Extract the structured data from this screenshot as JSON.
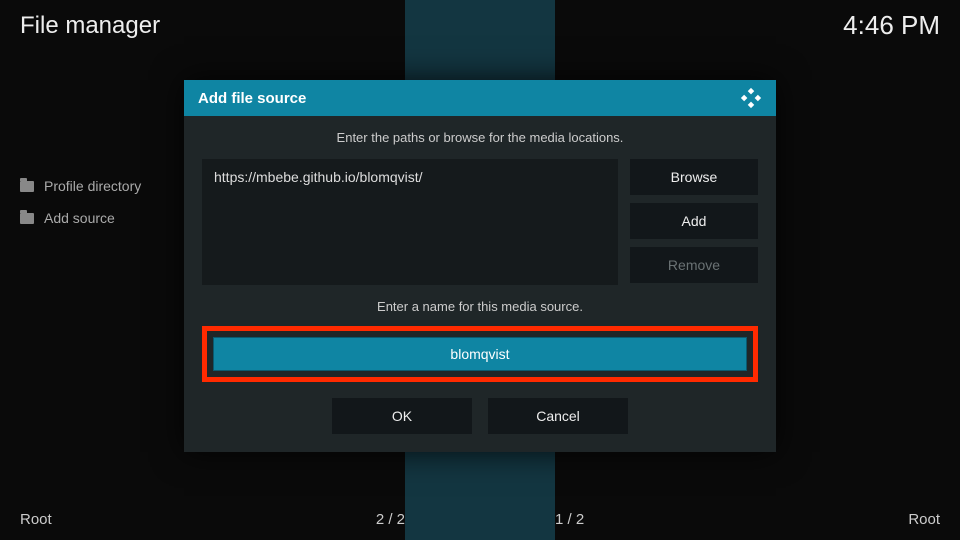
{
  "header": {
    "title": "File manager",
    "clock": "4:46 PM"
  },
  "sidebar": {
    "items": [
      {
        "label": "Profile directory"
      },
      {
        "label": "Add source"
      }
    ]
  },
  "dialog": {
    "title": "Add file source",
    "instruction_paths": "Enter the paths or browse for the media locations.",
    "path_value": "https://mbebe.github.io/blomqvist/",
    "browse_label": "Browse",
    "add_label": "Add",
    "remove_label": "Remove",
    "instruction_name": "Enter a name for this media source.",
    "name_value": "blomqvist",
    "ok_label": "OK",
    "cancel_label": "Cancel"
  },
  "footer": {
    "left": "Root",
    "center_left": "2 / 2",
    "center_right": "1 / 2",
    "right": "Root"
  }
}
